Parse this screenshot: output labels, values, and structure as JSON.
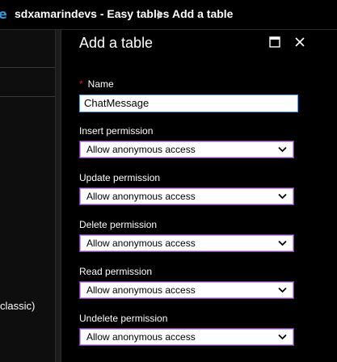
{
  "breadcrumb": {
    "edge_glyph": "e",
    "items": [
      "sdxamarindevs - Easy tables",
      "Add a table"
    ],
    "separator_icon": "chevron-right-icon"
  },
  "left_panel": {
    "partial_text": "classic)"
  },
  "blade": {
    "title": "Add a table",
    "maximize_icon": "maximize-icon",
    "close_icon": "close-icon"
  },
  "form": {
    "name": {
      "required_marker": "*",
      "label": "Name",
      "value": "ChatMessage"
    },
    "permissions": [
      {
        "label": "Insert permission",
        "value": "Allow anonymous access"
      },
      {
        "label": "Update permission",
        "value": "Allow anonymous access"
      },
      {
        "label": "Delete permission",
        "value": "Allow anonymous access"
      },
      {
        "label": "Read permission",
        "value": "Allow anonymous access"
      },
      {
        "label": "Undelete permission",
        "value": "Allow anonymous access"
      }
    ]
  },
  "colors": {
    "background": "#000000",
    "accent_blue": "#3c8fd6",
    "input_border": "#4aa3df",
    "select_border": "#7a3d9a",
    "required": "#e81123"
  }
}
